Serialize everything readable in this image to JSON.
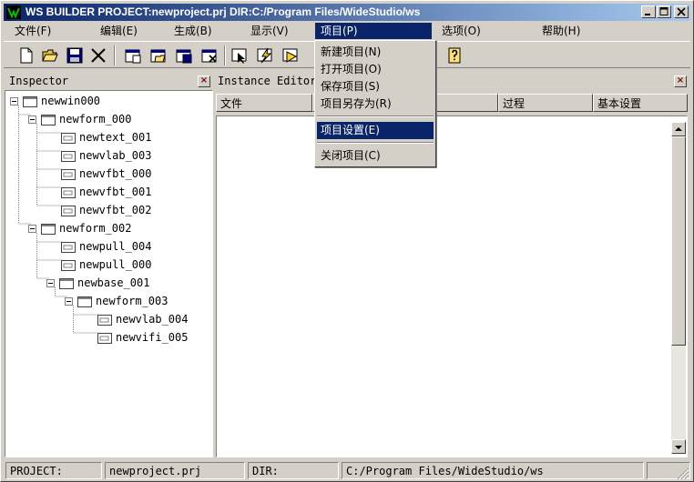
{
  "window": {
    "title": "WS BUILDER PROJECT:newproject.prj DIR:C:/Program Files/WideStudio/ws"
  },
  "menubar": {
    "items": [
      {
        "label": "文件(F)"
      },
      {
        "label": "编辑(E)"
      },
      {
        "label": "生成(B)"
      },
      {
        "label": "显示(V)"
      },
      {
        "label": "项目(P)"
      },
      {
        "label": "选项(O)"
      },
      {
        "label": "帮助(H)"
      }
    ]
  },
  "project_menu": {
    "items": [
      {
        "label": "新建项目(N)"
      },
      {
        "label": "打开项目(O)"
      },
      {
        "label": "保存项目(S)"
      },
      {
        "label": "项目另存为(R)"
      },
      {
        "label": "项目设置(E)"
      },
      {
        "label": "关闭项目(C)"
      }
    ],
    "highlighted": "项目设置(E)"
  },
  "toolbar": {
    "icons": [
      "new-file-icon",
      "open-folder-icon",
      "save-icon",
      "cut-icon",
      "new-window-icon",
      "open-window-icon",
      "save-window-icon",
      "close-window-icon",
      "select-icon",
      "build-icon",
      "run-icon",
      "help-icon"
    ]
  },
  "inspector": {
    "title": "Inspector",
    "tree": [
      {
        "label": "newwin000"
      },
      {
        "label": "newform_000"
      },
      {
        "label": "newtext_001"
      },
      {
        "label": "newvlab_003"
      },
      {
        "label": "newvfbt_000"
      },
      {
        "label": "newvfbt_001"
      },
      {
        "label": "newvfbt_002"
      },
      {
        "label": "newform_002"
      },
      {
        "label": "newpull_004"
      },
      {
        "label": "newpull_000"
      },
      {
        "label": "newbase_001"
      },
      {
        "label": "newform_003"
      },
      {
        "label": "newvlab_004"
      },
      {
        "label": "newvifi_005"
      }
    ]
  },
  "instance_editor": {
    "title": "Instance Editor",
    "columns": [
      "文件",
      "过程",
      "基本设置"
    ]
  },
  "statusbar": {
    "project_label": "PROJECT:",
    "project_value": "newproject.prj",
    "dir_label": "DIR:",
    "dir_value": "C:/Program Files/WideStudio/ws"
  },
  "colors": {
    "title_start": "#0a246a",
    "title_end": "#a6caf0",
    "face": "#d4d0c8",
    "highlight": "#0a246a"
  }
}
